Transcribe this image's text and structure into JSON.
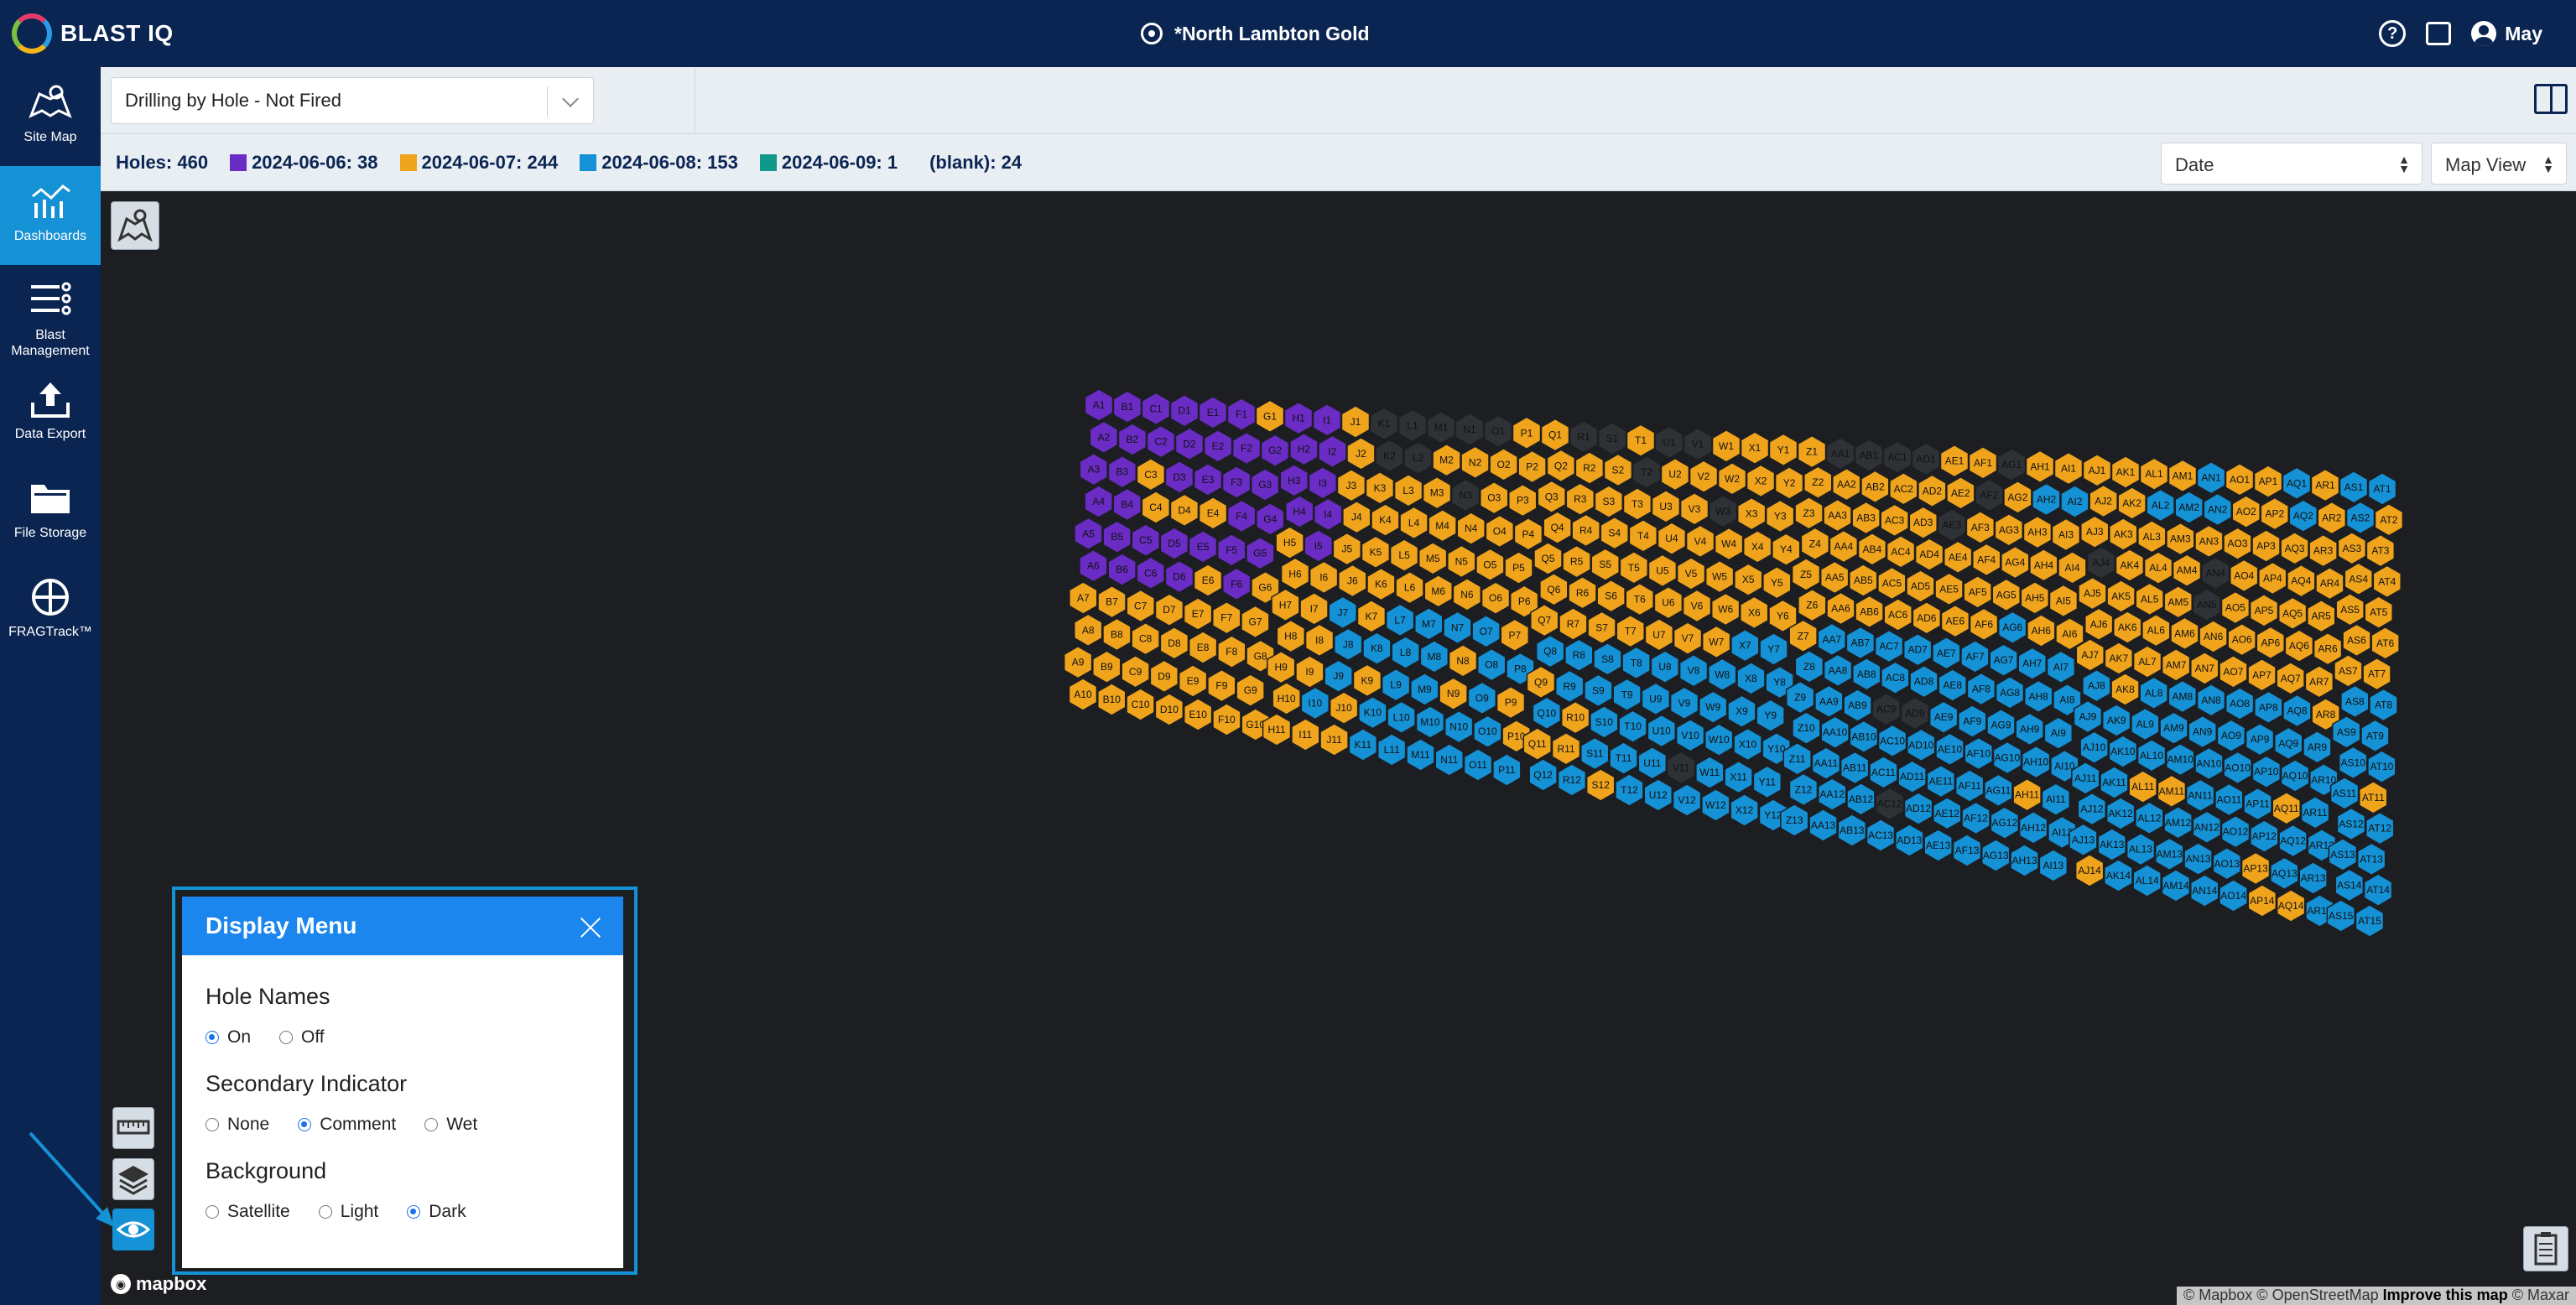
{
  "app": {
    "brand": "BLAST IQ",
    "site_title": "*North Lambton Gold",
    "user": "May"
  },
  "sidebar": {
    "items": [
      {
        "label": "Site Map",
        "icon": "map-icon"
      },
      {
        "label": "Dashboards",
        "icon": "dashboard-chart-icon"
      },
      {
        "label": "Blast Management",
        "icon": "blast-list-icon"
      },
      {
        "label": "Data Export",
        "icon": "upload-icon"
      },
      {
        "label": "File Storage",
        "icon": "folder-icon"
      },
      {
        "label": "FRAGTrack™",
        "icon": "fragtrack-icon"
      }
    ]
  },
  "toolbar": {
    "dashboard": "Drilling by Hole - Not Fired"
  },
  "legend": {
    "holes": "Holes: 460",
    "items": [
      {
        "label": "2024-06-06: 38",
        "color": "#6a2cc4"
      },
      {
        "label": "2024-06-07: 244",
        "color": "#f0a41c"
      },
      {
        "label": "2024-06-08: 153",
        "color": "#1591d5"
      },
      {
        "label": "2024-06-09: 1",
        "color": "#10988a"
      },
      {
        "label": "(blank): 24",
        "color": ""
      }
    ],
    "color_by": "Date",
    "view": "Map View"
  },
  "map": {
    "mapbox": "mapbox",
    "attribution_prefix": "© Mapbox © OpenStreetMap",
    "attribution_link": "Improve this map",
    "attribution_suffix": "© Maxar",
    "colors": {
      "purple": "#6a2cc4",
      "orange": "#f0a41c",
      "blue": "#1591d5",
      "teal": "#10988a",
      "blank": "#2e3136"
    }
  },
  "display_menu": {
    "title": "Display Menu",
    "hole_names": {
      "label": "Hole Names",
      "options": [
        "On",
        "Off"
      ],
      "selected": "On"
    },
    "secondary": {
      "label": "Secondary Indicator",
      "options": [
        "None",
        "Comment",
        "Wet"
      ],
      "selected": "Comment"
    },
    "background": {
      "label": "Background",
      "options": [
        "Satellite",
        "Light",
        "Dark"
      ],
      "selected": "Dark"
    }
  }
}
